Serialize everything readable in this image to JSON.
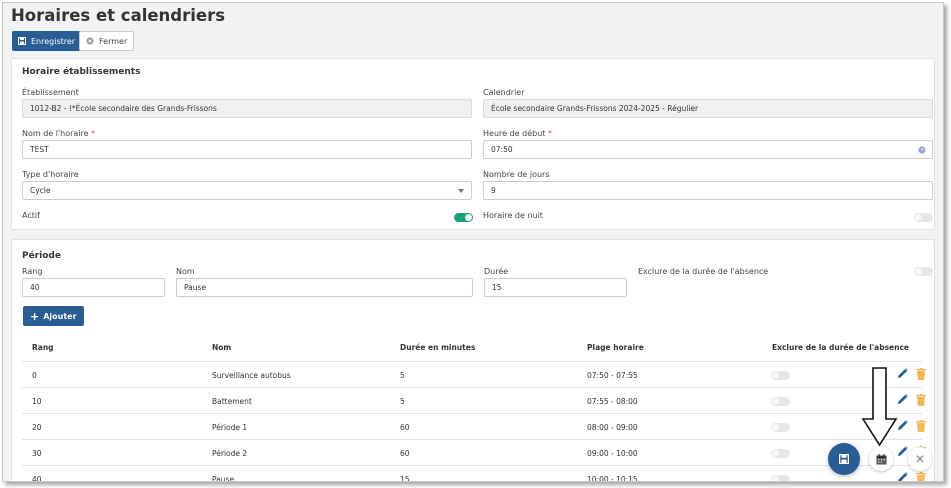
{
  "page_title": "Horaires et calendriers",
  "toolbar": {
    "save_label": "Enregistrer",
    "close_label": "Fermer"
  },
  "horaire": {
    "section_title": "Horaire établissements",
    "etablissement": {
      "label": "Établissement",
      "value": "1012-B2 - !*École secondaire des Grands-Frissons"
    },
    "calendrier": {
      "label": "Calendrier",
      "value": "École secondaire Grands-Frissons 2024-2025 - Régulier"
    },
    "nom": {
      "label": "Nom de l'horaire",
      "required_mark": "*",
      "value": "TEST"
    },
    "heure_debut": {
      "label": "Heure de début",
      "required_mark": "*",
      "value": "07:50"
    },
    "type": {
      "label": "Type d'horaire",
      "value": "Cycle"
    },
    "nb_jours": {
      "label": "Nombre de jours",
      "value": "9"
    },
    "actif": {
      "label": "Actif",
      "checked": true
    },
    "nuit": {
      "label": "Horaire de nuit",
      "checked": false
    }
  },
  "periode": {
    "section_title": "Période",
    "rang": {
      "label": "Rang",
      "value": "40"
    },
    "nom": {
      "label": "Nom",
      "value": "Pause"
    },
    "duree": {
      "label": "Durée",
      "value": "15"
    },
    "exclure": {
      "label": "Exclure de la durée de l'absence",
      "checked": false
    },
    "add_label": "Ajouter"
  },
  "table": {
    "headers": [
      "Rang",
      "Nom",
      "Durée en minutes",
      "Plage horaire",
      "Exclure de la durée de l'absence"
    ],
    "rows": [
      {
        "rang": "0",
        "nom": "Surveillance autobus",
        "duree": "5",
        "plage": "07:50 - 07:55",
        "exclure": false
      },
      {
        "rang": "10",
        "nom": "Battement",
        "duree": "5",
        "plage": "07:55 - 08:00",
        "exclure": false
      },
      {
        "rang": "20",
        "nom": "Période 1",
        "duree": "60",
        "plage": "08:00 - 09:00",
        "exclure": false
      },
      {
        "rang": "30",
        "nom": "Période 2",
        "duree": "60",
        "plage": "09:00 - 10:00",
        "exclure": false
      },
      {
        "rang": "40",
        "nom": "Pause",
        "duree": "15",
        "plage": "10:00 - 10:15",
        "exclure": false
      }
    ]
  },
  "fab": {
    "close_symbol": "✕"
  },
  "colors": {
    "primary": "#2a5d93",
    "toggle_on": "#1a9f79",
    "trash": "#f0b85a",
    "edit": "#2a5d93"
  },
  "icons": [
    "save-icon",
    "close-circle-icon",
    "clock-icon",
    "caret-down-icon",
    "plus-icon",
    "pencil-icon",
    "trash-icon",
    "calendar-icon",
    "close-icon"
  ]
}
